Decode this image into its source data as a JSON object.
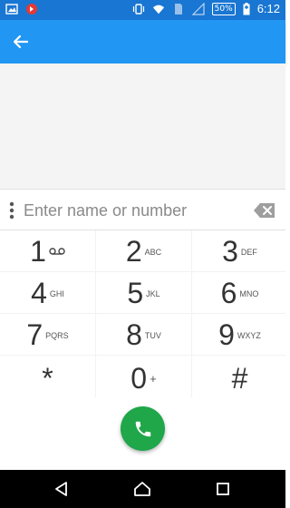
{
  "status_bar": {
    "battery": "50%",
    "time": "6:12"
  },
  "app_bar": {
    "back_icon": "arrow-back-icon"
  },
  "input": {
    "placeholder": "Enter name or number",
    "value": ""
  },
  "keypad": [
    {
      "digit": "1",
      "letters": "",
      "icon": "voicemail-icon"
    },
    {
      "digit": "2",
      "letters": "ABC"
    },
    {
      "digit": "3",
      "letters": "DEF"
    },
    {
      "digit": "4",
      "letters": "GHI"
    },
    {
      "digit": "5",
      "letters": "JKL"
    },
    {
      "digit": "6",
      "letters": "MNO"
    },
    {
      "digit": "7",
      "letters": "PQRS"
    },
    {
      "digit": "8",
      "letters": "TUV"
    },
    {
      "digit": "9",
      "letters": "WXYZ"
    },
    {
      "digit": "*",
      "letters": ""
    },
    {
      "digit": "0",
      "letters": "+"
    },
    {
      "digit": "#",
      "letters": ""
    }
  ],
  "colors": {
    "status_bar": "#1976d2",
    "app_bar": "#2196f3",
    "call_button": "#1fa74a",
    "nav_bar": "#000000"
  }
}
